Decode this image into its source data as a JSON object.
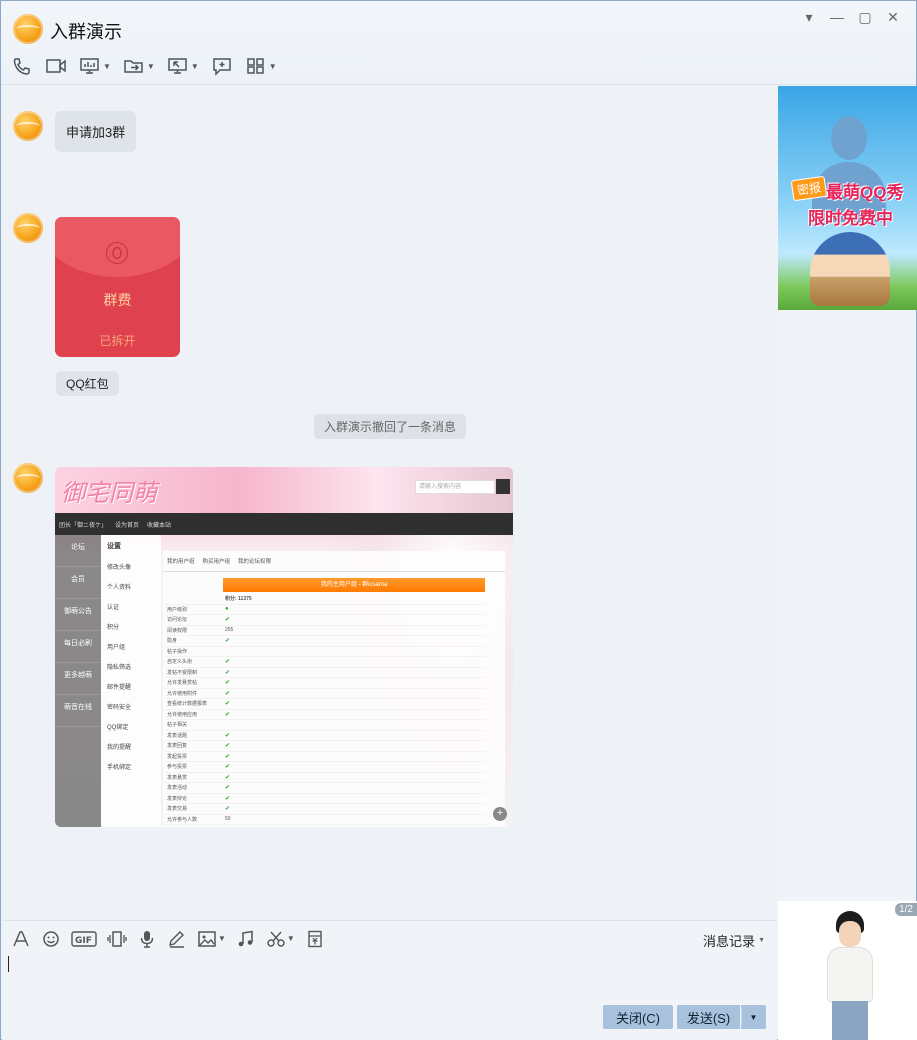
{
  "window": {
    "title": "入群演示"
  },
  "messages": {
    "text1": "申请加3群",
    "redpacket": {
      "label": "群费",
      "status": "已拆开",
      "tag": "QQ红包"
    },
    "system_tip": "入群演示撤回了一条消息"
  },
  "screenshot": {
    "logo_text": "御宅同萌",
    "search_placeholder": "请输入搜索内容",
    "nav": [
      "团长「御ニ夜ケ」",
      "设为首页",
      "收藏本站"
    ],
    "side_items": [
      "论坛",
      "会员",
      "御萌公告",
      "每日必刷",
      "更多越萌",
      "萌音在线"
    ],
    "menu_title": "设置",
    "menu_items": [
      "修改头像",
      "个人资料",
      "认证",
      "积分",
      "用户组",
      "隐私筛选",
      "邮件提醒",
      "密码安全",
      "QQ绑定",
      "我的提醒",
      "手机绑定"
    ],
    "tabs": [
      "我的用户组",
      "购买用户组",
      "我的论坛权限"
    ],
    "banner": "我的主用户组 - 群icsama",
    "points": "积分: 11375",
    "rows": [
      "用户级别",
      "访问论坛",
      "阅读权限",
      "隐身",
      "帖子操作",
      "自定义头衔",
      "发帖不受限制",
      "允许发悬赏帖",
      "允许使用附件",
      "查看统计数据报表",
      "允许使用应用",
      "帖子相关",
      "发表话题",
      "发表回复",
      "发起投票",
      "参与投票",
      "发表悬赏",
      "发表活动",
      "发表辩论",
      "发表交易",
      "允许参与人数"
    ]
  },
  "ad": {
    "tag": "密报",
    "line1": "最萌QQ秀",
    "line2": "限时免费中"
  },
  "avatar_panel": {
    "page": "1/2"
  },
  "input": {
    "history_label": "消息记录",
    "close_label": "关闭(C)",
    "send_label": "发送(S)"
  },
  "colors": {
    "accent": "#a8c2dd",
    "redpacket": "#e0414e"
  }
}
